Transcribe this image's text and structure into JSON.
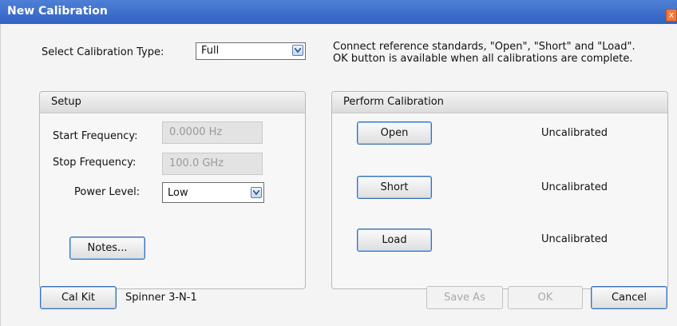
{
  "window": {
    "title": "New Calibration",
    "close_glyph": "x"
  },
  "cal_type": {
    "label": "Select Calibration Type:",
    "value": "Full"
  },
  "instructions": {
    "line1": "Connect reference standards, \"Open\", \"Short\" and \"Load\".",
    "line2": "OK button is available when all calibrations are complete."
  },
  "setup": {
    "title": "Setup",
    "start_label": "Start Frequency:",
    "start_value": "0.0000 Hz",
    "stop_label": "Stop Frequency:",
    "stop_value": "100.0 GHz",
    "power_label": "Power Level:",
    "power_value": "Low",
    "notes_button": "Notes..."
  },
  "perform": {
    "title": "Perform Calibration",
    "rows": [
      {
        "button": "Open",
        "status": "Uncalibrated"
      },
      {
        "button": "Short",
        "status": "Uncalibrated"
      },
      {
        "button": "Load",
        "status": "Uncalibrated"
      }
    ]
  },
  "footer": {
    "calkit_button": "Cal Kit",
    "calkit_name": "Spinner 3-N-1",
    "save_as_button": "Save As",
    "ok_button": "OK",
    "cancel_button": "Cancel"
  },
  "colors": {
    "title_bar": "#2f63c4",
    "accent": "#3a6fb3",
    "close": "#f07a3c"
  }
}
